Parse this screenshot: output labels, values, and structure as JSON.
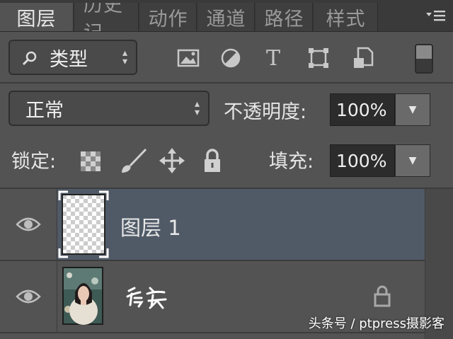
{
  "tabs": [
    {
      "label": "图层",
      "active": true
    },
    {
      "label": "历史记",
      "active": false
    },
    {
      "label": "动作",
      "active": false
    },
    {
      "label": "通道",
      "active": false
    },
    {
      "label": "路径",
      "active": false
    },
    {
      "label": "样式",
      "active": false
    }
  ],
  "filter": {
    "kind_label": "类型",
    "icons": [
      "image-filter-icon",
      "adjustment-filter-icon",
      "text-filter-icon",
      "shape-filter-icon",
      "smart-object-filter-icon"
    ],
    "text_icon_glyph": "T"
  },
  "blend": {
    "mode_value": "正常",
    "opacity_label": "不透明度:",
    "opacity_value": "100%"
  },
  "lock": {
    "label": "锁定:",
    "fill_label": "填充:",
    "fill_value": "100%"
  },
  "layers": [
    {
      "name": "图层 1",
      "selected": true,
      "visible": true,
      "locked": false
    },
    {
      "name": "背景",
      "selected": false,
      "visible": true,
      "locked": true
    }
  ],
  "watermark": "头条号 / ptpress摄影客",
  "colors": {
    "panel_bg": "#535353",
    "selected_row": "#505a67",
    "field_bg": "#2c2c2c"
  }
}
